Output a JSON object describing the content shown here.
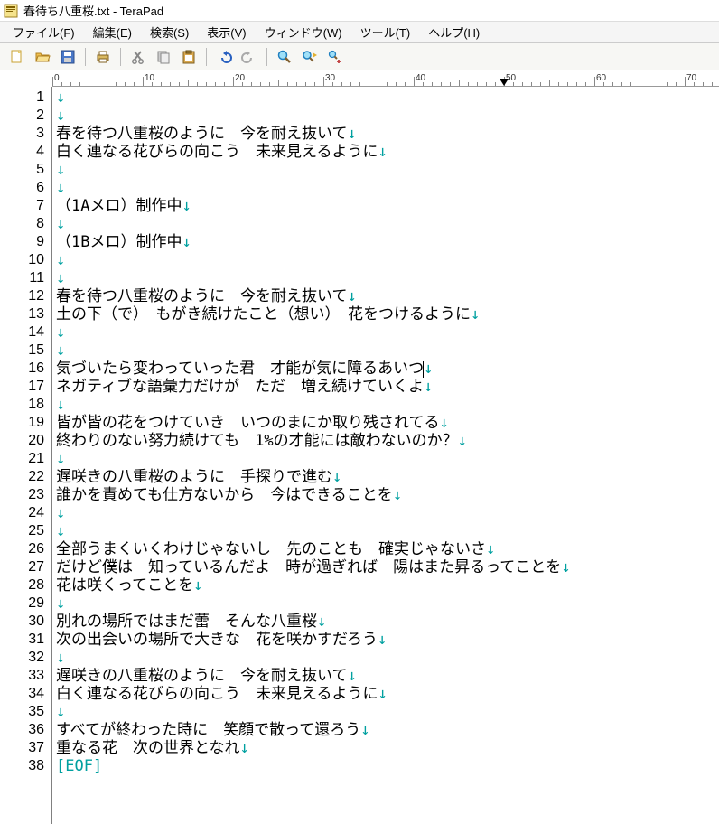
{
  "window": {
    "title": "春待ち八重桜.txt - TeraPad"
  },
  "menus": [
    {
      "label": "ファイル(F)"
    },
    {
      "label": "編集(E)"
    },
    {
      "label": "検索(S)"
    },
    {
      "label": "表示(V)"
    },
    {
      "label": "ウィンドウ(W)"
    },
    {
      "label": "ツール(T)"
    },
    {
      "label": "ヘルプ(H)"
    }
  ],
  "toolbar_icons": {
    "new": "new-file-icon",
    "open": "open-file-icon",
    "save": "save-icon",
    "printer": "printer-icon",
    "cut": "cut-icon",
    "copy": "copy-icon",
    "paste": "paste-icon",
    "undo": "undo-icon",
    "redo": "redo-icon",
    "find": "find-icon",
    "find_next": "find-next-icon",
    "replace": "replace-icon"
  },
  "ruler": {
    "labels": [
      "0",
      "10",
      "20",
      "30",
      "40",
      "50",
      "60",
      "70"
    ],
    "marker_at": 50
  },
  "lines": [
    "",
    "",
    "春を待つ八重桜のように　今を耐え抜いて",
    "白く連なる花びらの向こう　未来見えるように",
    "",
    "",
    "（1Aメロ）制作中",
    "",
    "（1Bメロ）制作中",
    "",
    "",
    "春を待つ八重桜のように　今を耐え抜いて",
    "土の下（で）　もがき続けたこと（想い）　花をつけるように",
    "",
    "",
    "気づいたら変わっていった君　才能が気に障るあいつ",
    "ネガティブな語彙力だけが　ただ　増え続けていくよ",
    "",
    "皆が皆の花をつけていき　いつのまにか取り残されてる",
    "終わりのない努力続けても　1%の才能には敵わないのか？",
    "",
    "遅咲きの八重桜のように　手探りで進む",
    "誰かを責めても仕方ないから　今はできることを",
    "",
    "",
    "全部うまくいくわけじゃないし　先のことも　確実じゃないさ",
    "だけど僕は　知っているんだよ　時が過ぎれば　陽はまた昇るってことを",
    "花は咲くってことを",
    "",
    "別れの場所ではまだ蕾　そんな八重桜",
    "次の出会いの場所で大きな　花を咲かすだろう",
    "",
    "遅咲きの八重桜のように　今を耐え抜いて",
    "白く連なる花びらの向こう　未来見えるように",
    "",
    "すべてが終わった時に　笑顔で散って還ろう",
    "重なる花　次の世界となれ"
  ],
  "eof_label": "[EOF]",
  "caret_line": 16,
  "colors": {
    "newline_mark": "#00a0a0",
    "text": "#000000"
  }
}
